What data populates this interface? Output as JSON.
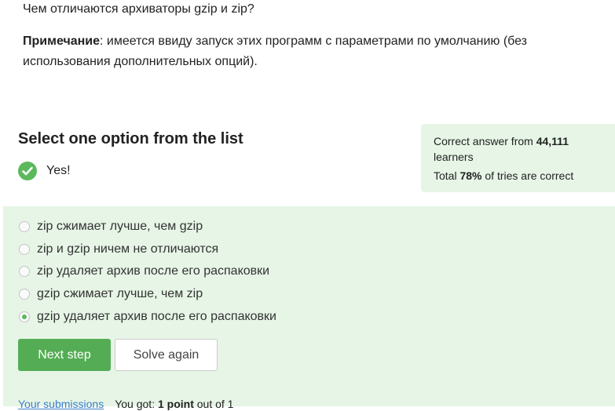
{
  "question": {
    "title": "Чем отличаются архиваторы gzip и zip?",
    "note_label": "Примечание",
    "note_text": ": имеется ввиду запуск этих программ с параметрами по умолчанию (без использования дополнительных опций)."
  },
  "quiz": {
    "heading": "Select one option from the list",
    "result_text": "Yes!",
    "options": [
      {
        "label": "zip сжимает лучше, чем gzip",
        "selected": false
      },
      {
        "label": "zip и gzip ничем не отличаются",
        "selected": false
      },
      {
        "label": "zip удаляет архив после его распаковки",
        "selected": false
      },
      {
        "label": "gzip сжимает лучше, чем zip",
        "selected": false
      },
      {
        "label": "gzip удаляет архив после его распаковки",
        "selected": true
      }
    ],
    "next_button": "Next step",
    "solve_again_button": "Solve again"
  },
  "stats": {
    "correct_prefix": "Correct answer from ",
    "learners_count": "44,111",
    "learners_suffix": " learners",
    "total_prefix": "Total ",
    "percent": "78%",
    "total_suffix": " of tries are correct"
  },
  "footer": {
    "submissions_link": "Your submissions",
    "got_prefix": "You got: ",
    "points": "1 point",
    "got_suffix": " out of 1"
  },
  "colors": {
    "accent_green": "#54ad54",
    "panel_green": "#e6f5e6",
    "link_blue": "#3a7ec9"
  }
}
